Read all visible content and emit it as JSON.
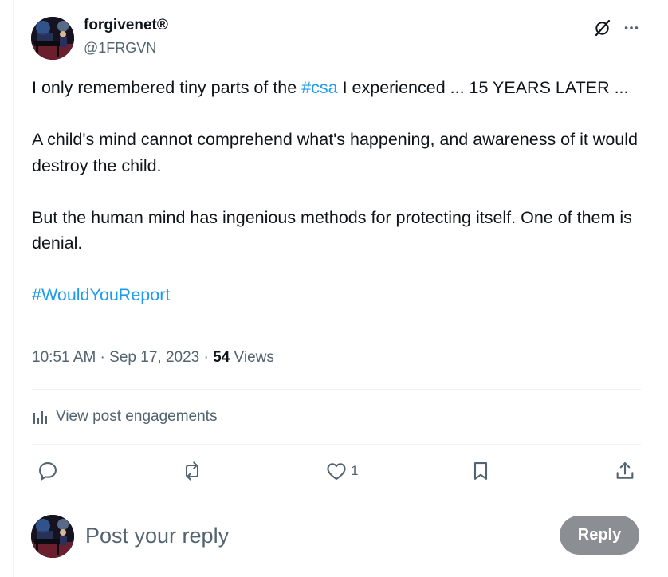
{
  "author": {
    "display_name": "forgivenet®",
    "handle": "@1FRGVN"
  },
  "icons": {
    "grok": "grok-icon",
    "more": "more-icon",
    "engagements": "bar-chart-icon",
    "reply": "reply-icon",
    "repost": "repost-icon",
    "like": "heart-icon",
    "bookmark": "bookmark-icon",
    "share": "share-icon"
  },
  "post": {
    "p1_before": "I only remembered tiny parts of the ",
    "p1_tag": "#csa",
    "p1_after": " I experienced ... 15 YEARS LATER ...",
    "p2": "A child's mind cannot comprehend what's happening, and awareness of it would destroy the child.",
    "p3": "But the human mind has ingenious methods for protecting itself. One of them is denial.",
    "hashtag": "#WouldYouReport"
  },
  "meta": {
    "time": "10:51 AM",
    "separator": " · ",
    "date": "Sep 17, 2023",
    "views_count": "54",
    "views_label": " Views"
  },
  "engagements": {
    "label": "View post engagements"
  },
  "actions": {
    "like_count": "1"
  },
  "reply": {
    "placeholder": "Post your reply",
    "button_label": "Reply"
  },
  "colors": {
    "link": "#1d9bf0",
    "secondary_text": "#536471",
    "primary_text": "#0f1419",
    "reply_button": "#8b8f93",
    "divider": "#eff3f4"
  }
}
